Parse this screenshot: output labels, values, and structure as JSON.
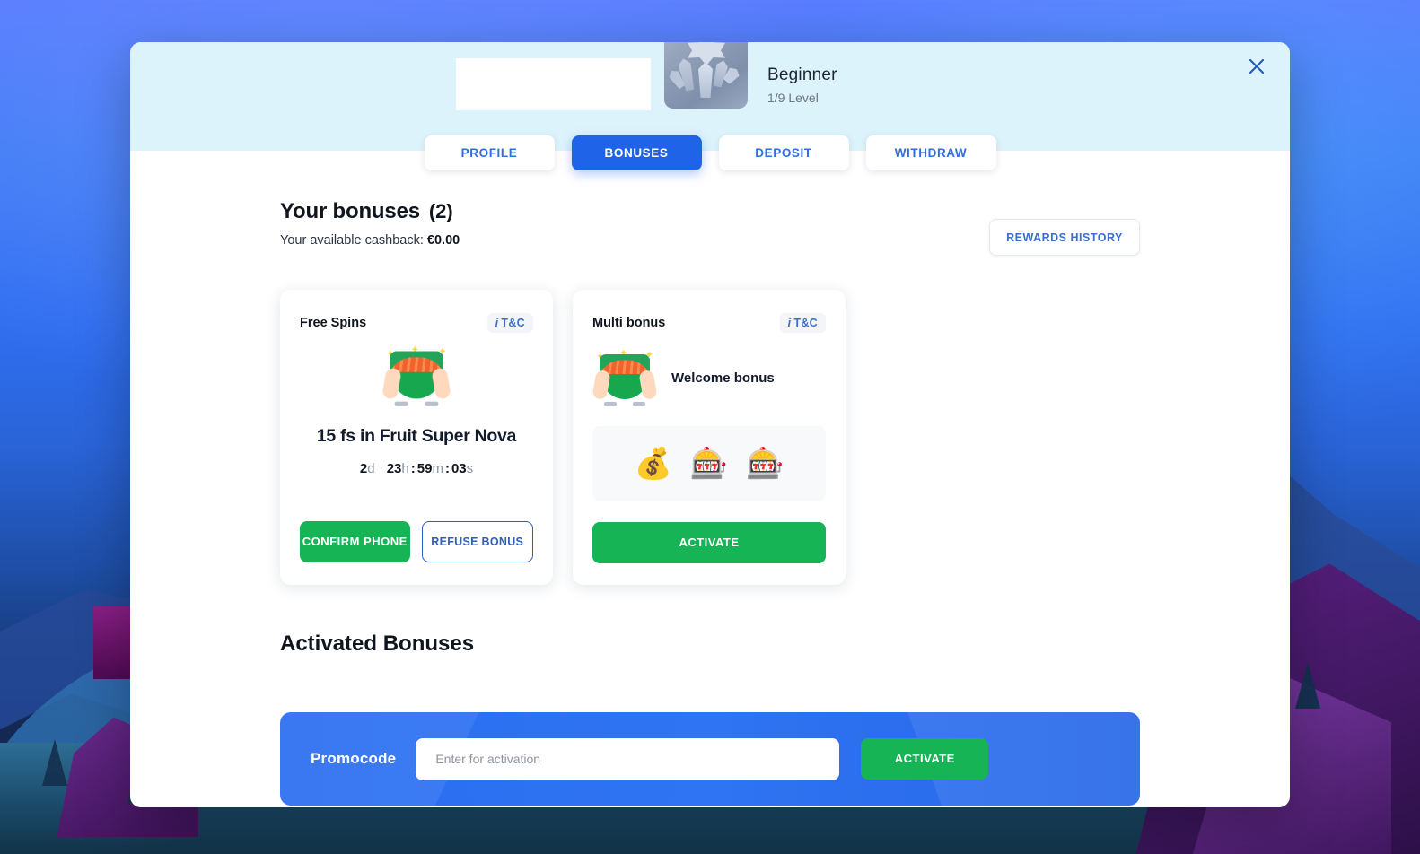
{
  "header": {
    "rank_title": "Beginner",
    "rank_level": "1/9 Level",
    "close_icon": "close-icon",
    "badge_icon": "crystal-rank-badge-icon"
  },
  "tabs": [
    {
      "label": "PROFILE",
      "active": false
    },
    {
      "label": "BONUSES",
      "active": true
    },
    {
      "label": "DEPOSIT",
      "active": false
    },
    {
      "label": "WITHDRAW",
      "active": false
    }
  ],
  "bonuses_section": {
    "title": "Your bonuses",
    "count": "(2)",
    "cashback_label": "Your available cashback:",
    "cashback_value": "€0.00",
    "rewards_history_label": "REWARDS HISTORY"
  },
  "cards": {
    "free_spins": {
      "kind": "Free Spins",
      "tc_i": "i",
      "tc_label": "T&C",
      "icon": "money-in-hands-icon",
      "name": "15 fs in Fruit Super Nova",
      "countdown": {
        "days": "2",
        "days_unit": "d",
        "hours": "23",
        "hours_unit": "h",
        "minutes": "59",
        "minutes_unit": "m",
        "seconds": "03",
        "seconds_unit": "s",
        "separator": ":"
      },
      "confirm_label": "CONFIRM PHONE",
      "refuse_label": "REFUSE BONUS"
    },
    "multi_bonus": {
      "kind": "Multi bonus",
      "tc_i": "i",
      "tc_label": "T&C",
      "icon": "money-in-hands-icon",
      "name": "Welcome bonus",
      "items": [
        {
          "icon": "money-bag-icon",
          "glyph": "💰"
        },
        {
          "icon": "slot-machine-icon",
          "glyph": "🎰"
        },
        {
          "icon": "slot-machine-icon",
          "glyph": "🎰"
        }
      ],
      "activate_label": "ACTIVATE"
    }
  },
  "activated": {
    "title": "Activated Bonuses"
  },
  "promocode": {
    "label": "Promocode",
    "placeholder": "Enter for activation",
    "value": "",
    "activate_label": "ACTIVATE"
  },
  "colors": {
    "accent_blue": "#1f63e8",
    "green": "#16b454",
    "header_bg": "#ddf3fb",
    "link_blue": "#3a6fcf"
  }
}
